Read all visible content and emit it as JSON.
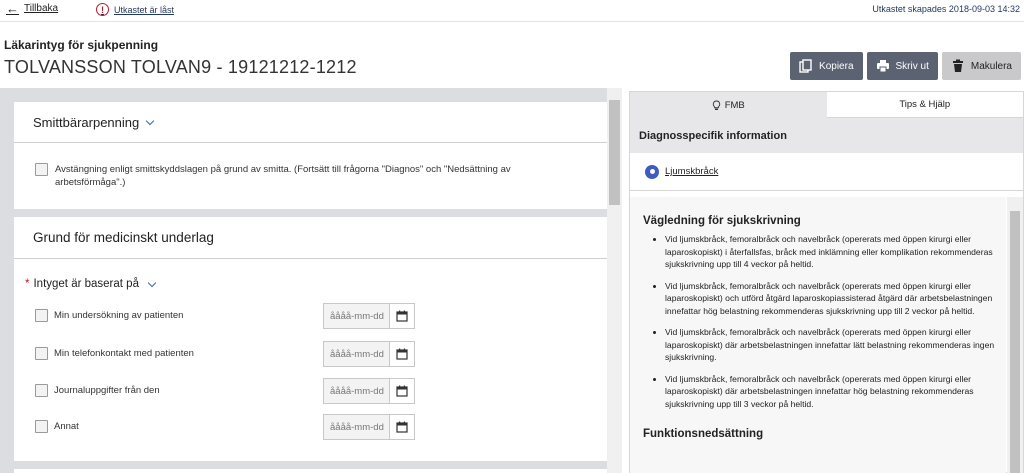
{
  "topbar": {
    "back_label": "Tillbaka",
    "draft_status": "Utkastet är låst",
    "created": "Utkastet skapades 2018-09-03 14:32"
  },
  "header": {
    "doc_type": "Läkarintyg för sjukpenning",
    "patient": "TOLVANSSON TOLVAN9 - 19121212-1212"
  },
  "actions": {
    "copy": "Kopiera",
    "print": "Skriv ut",
    "discard": "Makulera"
  },
  "smitta": {
    "title": "Smittbärarpenning",
    "checkbox_label": "Avstängning enligt smittskyddslagen på grund av smitta. (Fortsätt till frågorna \"Diagnos\" och \"Nedsättning av arbetsförmåga\".)"
  },
  "grund": {
    "title": "Grund för medicinskt underlag",
    "required_mark": "*",
    "question": "Intyget är baserat på",
    "date_placeholder": "åååå-mm-dd",
    "options": [
      "Min undersökning av patienten",
      "Min telefonkontakt med patienten",
      "Journaluppgifter från den",
      "Annat"
    ]
  },
  "panel": {
    "tabs": [
      "FMB",
      "Tips & Hjälp"
    ],
    "diag_header": "Diagnosspecifik information",
    "diagnosis": "Ljumskbråck",
    "guide_title": "Vägledning för sjukskrivning",
    "guide_items": [
      "Vid ljumskbråck, femoralbråck och navelbråck (opererats med öppen kirurgi eller laparoskopiskt) i återfallsfas, bråck med inklämning eller komplikation rekommenderas sjukskrivning upp till 4 veckor på heltid.",
      "Vid ljumskbråck, femoralbråck och navelbråck (opererats med öppen kirurgi eller laparoskopiskt) och utförd åtgärd laparoskopiassisterad åtgärd där arbetsbelastningen innefattar hög belastning rekommenderas sjukskrivning upp till 2 veckor på heltid.",
      "Vid ljumskbråck, femoralbråck och navelbråck (opererats med öppen kirurgi eller laparoskopiskt) där arbetsbelastningen innefattar lätt belastning rekommenderas ingen sjukskrivning.",
      "Vid ljumskbråck, femoralbråck och navelbråck (opererats med öppen kirurgi eller laparoskopiskt) där arbetsbelastningen innefattar hög belastning rekommenderas sjukskrivning upp till 3 veckor på heltid."
    ],
    "func_title": "Funktionsnedsättning"
  },
  "colors": {
    "button_dark": "#5b6272",
    "button_light": "#c9c9cb",
    "accent_blue": "#3e5ac7",
    "alert_red": "#c0182e"
  }
}
